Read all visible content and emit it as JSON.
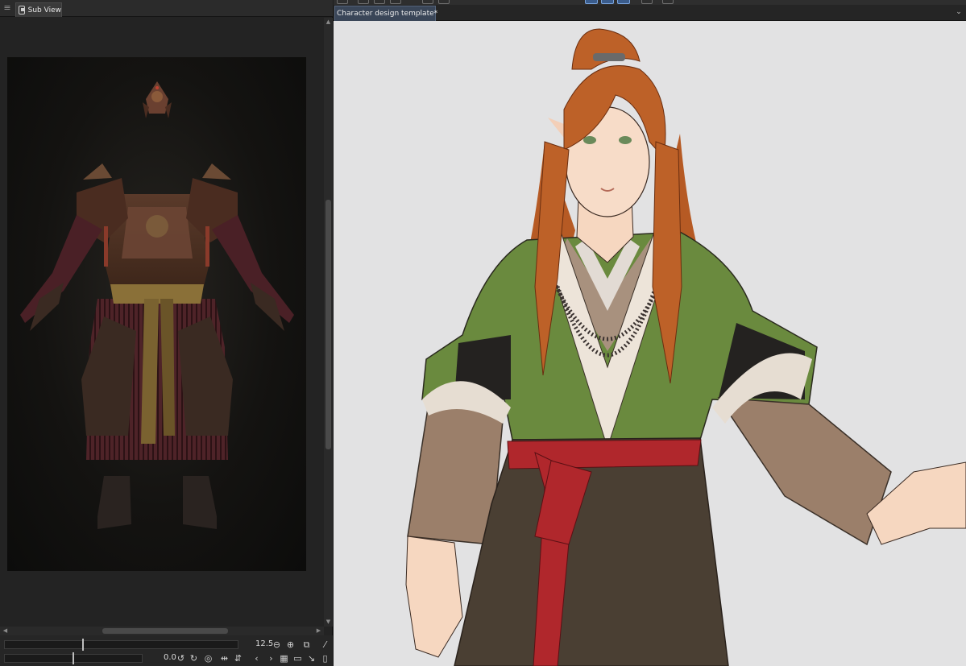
{
  "subview": {
    "tab_label": "Sub View",
    "zoom_value": "12.5",
    "rotate_value": "0.0"
  },
  "canvas": {
    "document_tab_label": "Character design template*"
  },
  "icons": {
    "panel_menu": "menu-icon",
    "subview_tab": "subview-icon",
    "zoom_out": "minus-circle-icon",
    "zoom_in": "plus-circle-icon",
    "fit": "fit-window-icon",
    "eyedropper": "eyedropper-icon",
    "rotate_left": "rotate-left-icon",
    "rotate_right": "rotate-right-icon",
    "reset_rotate": "reset-rotate-icon",
    "flip_h": "flip-horizontal-icon",
    "flip_v": "flip-vertical-icon",
    "prev_image": "chevron-left-icon",
    "next_image": "chevron-right-icon",
    "grid_view": "grid-icon",
    "open_image": "folder-icon",
    "import": "import-icon",
    "delete": "trash-icon"
  },
  "colors": {
    "panel_bg": "#232323",
    "canvas_bg": "#e2e2e3",
    "active_tab": "#3a4658",
    "accent": "#3a5c8c"
  }
}
